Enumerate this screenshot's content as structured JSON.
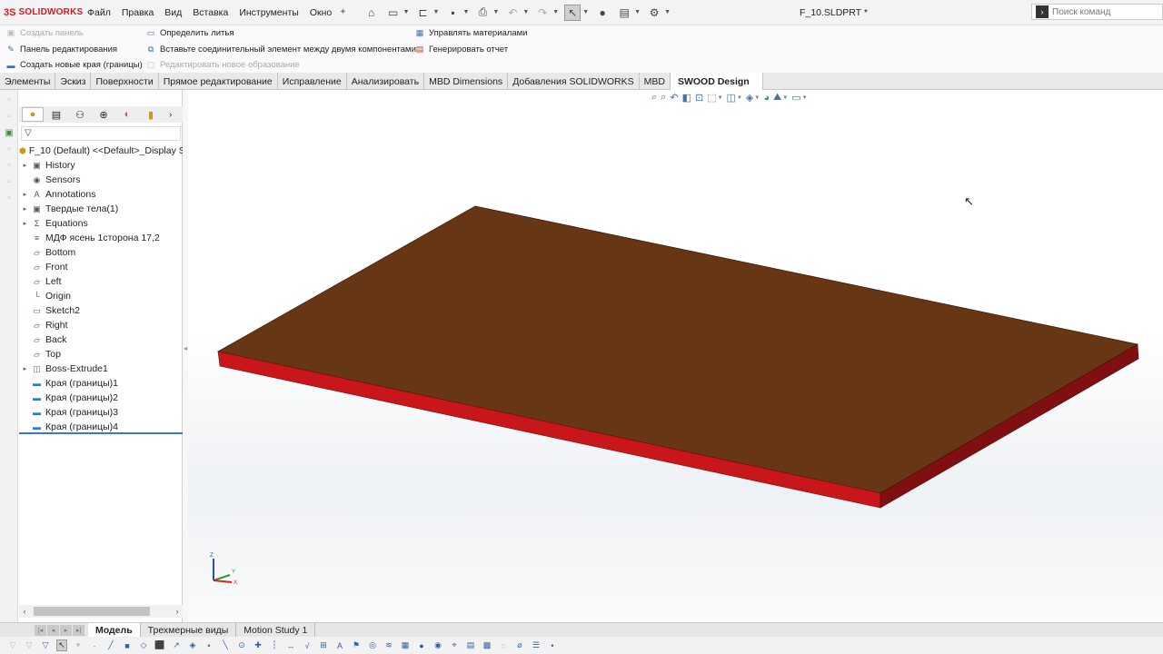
{
  "app": {
    "logo_mark": "3S",
    "logo_text": "SOLIDWORKS",
    "document_title": "F_10.SLDPRT *"
  },
  "menu": [
    "Файл",
    "Правка",
    "Вид",
    "Вставка",
    "Инструменты",
    "Окно"
  ],
  "search": {
    "placeholder": "Поиск команд"
  },
  "ribbon": {
    "col1": [
      {
        "label": "Создать панель",
        "disabled": true
      },
      {
        "label": "Панель редактирования",
        "disabled": false
      },
      {
        "label": "Создать новые края (границы)",
        "disabled": false
      }
    ],
    "col2": [
      {
        "label": "Определить литья",
        "disabled": false
      },
      {
        "label": "Вставьте соединительный элемент между двумя компонентами",
        "disabled": false
      },
      {
        "label": "Редактировать новое образование",
        "disabled": true
      }
    ],
    "col3": [
      {
        "label": "Управлять материалами",
        "disabled": false
      },
      {
        "label": "Генерировать отчет",
        "disabled": false
      }
    ]
  },
  "tabs": [
    "Элементы",
    "Эскиз",
    "Поверхности",
    "Прямое редактирование",
    "Исправление",
    "Анализировать",
    "MBD Dimensions",
    "Добавления SOLIDWORKS",
    "MBD",
    "SWOOD Design"
  ],
  "active_tab": "SWOOD Design",
  "tree": {
    "root": "F_10 (Default) <<Default>_Display S",
    "items": [
      {
        "label": "History",
        "expandable": true,
        "icon": "folder-icon"
      },
      {
        "label": "Sensors",
        "expandable": false,
        "icon": "sensor-icon"
      },
      {
        "label": "Annotations",
        "expandable": true,
        "icon": "annotation-icon"
      },
      {
        "label": "Твердые тела(1)",
        "expandable": true,
        "icon": "solid-bodies-icon"
      },
      {
        "label": "Equations",
        "expandable": true,
        "icon": "equation-icon"
      },
      {
        "label": "МДФ ясень 1сторона 17,2",
        "expandable": false,
        "icon": "material-icon"
      },
      {
        "label": "Bottom",
        "expandable": false,
        "icon": "plane-icon"
      },
      {
        "label": "Front",
        "expandable": false,
        "icon": "plane-icon"
      },
      {
        "label": "Left",
        "expandable": false,
        "icon": "plane-icon"
      },
      {
        "label": "Origin",
        "expandable": false,
        "icon": "origin-icon"
      },
      {
        "label": "Sketch2",
        "expandable": false,
        "icon": "sketch-icon"
      },
      {
        "label": "Right",
        "expandable": false,
        "icon": "plane-icon"
      },
      {
        "label": "Back",
        "expandable": false,
        "icon": "plane-icon"
      },
      {
        "label": "Top",
        "expandable": false,
        "icon": "plane-icon"
      },
      {
        "label": "Boss-Extrude1",
        "expandable": true,
        "icon": "extrude-icon"
      },
      {
        "label": "Края (границы)1",
        "expandable": false,
        "icon": "edge-band-icon"
      },
      {
        "label": "Края (границы)2",
        "expandable": false,
        "icon": "edge-band-icon"
      },
      {
        "label": "Края (границы)3",
        "expandable": false,
        "icon": "edge-band-icon"
      },
      {
        "label": "Края (границы)4",
        "expandable": false,
        "icon": "edge-band-icon"
      }
    ]
  },
  "model": {
    "top_color": "#673614",
    "front_color": "#c8161a",
    "side_color": "#7f0f10"
  },
  "triad": {
    "z": "Z",
    "y": "Y",
    "x": "X"
  },
  "bottom_tabs": [
    "Модель",
    "Трехмерные виды",
    "Motion Study 1"
  ],
  "active_bottom_tab": "Модель"
}
